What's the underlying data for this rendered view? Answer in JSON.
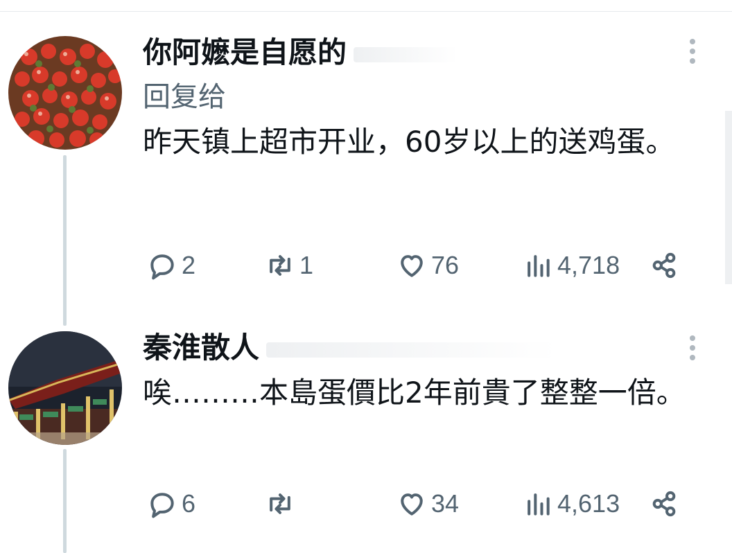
{
  "posts": [
    {
      "author": "你阿嬷是自愿的",
      "reply_to": "回复给",
      "text": "昨天镇上超市开业，60岁以上的送鸡蛋。",
      "avatar_icon": "red-fruit-avatar",
      "replies": "2",
      "reposts": "1",
      "likes": "76",
      "views": "4,718"
    },
    {
      "author": "秦淮散人",
      "text": "唉………本島蛋價比2年前貴了整整一倍。",
      "avatar_icon": "temple-night-avatar",
      "replies": "6",
      "reposts": "",
      "likes": "34",
      "views": "4,613"
    }
  ],
  "colors": {
    "text": "#0f1419",
    "muted": "#536471",
    "thread_line": "#cfd9de"
  }
}
